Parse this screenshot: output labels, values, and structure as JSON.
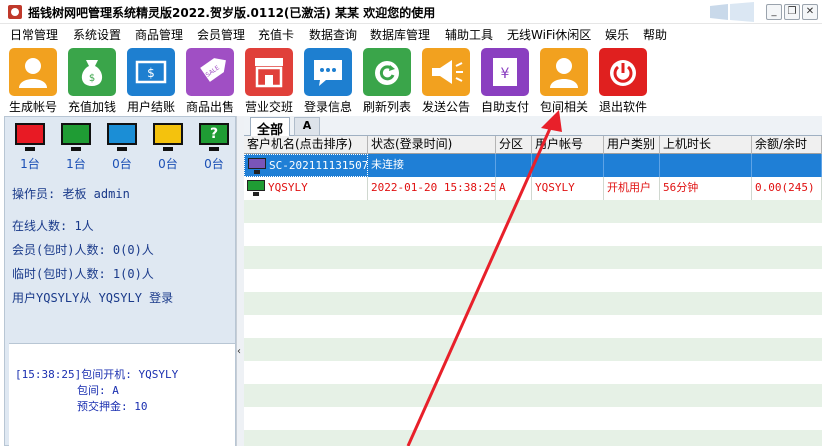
{
  "window": {
    "title": "摇钱树网吧管理系统精灵版2022.贺岁版.0112(已激活)  某某 欢迎您的使用",
    "controls": {
      "minimize": "_",
      "restore": "❐",
      "close": "✕"
    }
  },
  "menu": [
    "日常管理",
    "系统设置",
    "商品管理",
    "会员管理",
    "充值卡",
    "数据查询",
    "数据库管理",
    "辅助工具",
    "无线WiFi休闲区",
    "娱乐",
    "帮助"
  ],
  "toolbar": [
    {
      "label": "生成帐号",
      "color": "#f2a11f",
      "icon": "user-icon"
    },
    {
      "label": "充值加钱",
      "color": "#3aa54a",
      "icon": "money-bag-icon"
    },
    {
      "label": "用户结账",
      "color": "#1e7fd0",
      "icon": "dollar-bill-icon"
    },
    {
      "label": "商品出售",
      "color": "#a04fc4",
      "icon": "sale-tag-icon"
    },
    {
      "label": "营业交班",
      "color": "#e0403a",
      "icon": "shop-icon"
    },
    {
      "label": "登录信息",
      "color": "#1e7fd0",
      "icon": "chat-icon"
    },
    {
      "label": "刷新列表",
      "color": "#3aa54a",
      "icon": "refresh-icon"
    },
    {
      "label": "发送公告",
      "color": "#f2a11f",
      "icon": "megaphone-icon"
    },
    {
      "label": "自助支付",
      "color": "#8a3fc0",
      "icon": "yen-icon"
    },
    {
      "label": "包间相关",
      "color": "#f2a11f",
      "icon": "user-room-icon"
    },
    {
      "label": "退出软件",
      "color": "#e0201f",
      "icon": "power-icon"
    }
  ],
  "status_monitors": [
    {
      "color": "#e81a24",
      "count": "1台"
    },
    {
      "color": "#1f9c34",
      "count": "1台"
    },
    {
      "color": "#1b8ed6",
      "count": "0台"
    },
    {
      "color": "#f4c20d",
      "count": "0台"
    },
    {
      "color": "#1f9c34",
      "count": "0台",
      "badge": "?"
    }
  ],
  "left_info": {
    "operator": "操作员:  老板 admin",
    "online": "在线人数: 1人",
    "members": "会员(包时)人数: 0(0)人",
    "temp": "临时(包时)人数: 1(0)人",
    "login_msg": "用户YQSYLY从 YQSYLY 登录"
  },
  "log": {
    "line1": "[15:38:25]包间开机: YQSYLY",
    "line2": "包间: A",
    "line3": "预交押金: 10"
  },
  "tabs": {
    "all": "全部",
    "a": "A"
  },
  "table": {
    "headers": [
      "客户机名(点击排序)",
      "状态(登录时间)",
      "分区",
      "用户帐号",
      "用户类别",
      "上机时长",
      "余额/余时"
    ],
    "rows": [
      {
        "machine": "SC-202111131507",
        "status": "未连接",
        "zone": "",
        "account": "",
        "type": "",
        "duration": "",
        "balance": ""
      },
      {
        "machine": "YQSYLY",
        "status": "2022-01-20 15:38:25",
        "zone": "A",
        "account": "YQSYLY",
        "type": "开机用户",
        "duration": "56分钟",
        "balance": "0.00(245)"
      }
    ]
  },
  "colors": {
    "selected_row": "#1f7fd6",
    "alt_row": "#e6f1e6",
    "arrow": "#e8202a"
  }
}
